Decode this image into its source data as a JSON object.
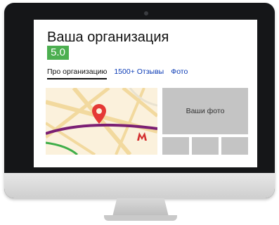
{
  "organization": {
    "title": "Ваша организация",
    "rating": "5.0"
  },
  "tabs": [
    {
      "label": "Про организацию",
      "active": true
    },
    {
      "label": "1500+ Отзывы",
      "active": false
    },
    {
      "label": "Фото",
      "active": false
    }
  ],
  "photos": {
    "label": "Ваши фото"
  },
  "colors": {
    "rating_bg": "#4caf50",
    "link": "#0b3bb5",
    "pin": "#e53935",
    "metro": "#d32f2f"
  },
  "icons": {
    "map_pin": "map-pin-icon",
    "metro": "metro-icon"
  }
}
